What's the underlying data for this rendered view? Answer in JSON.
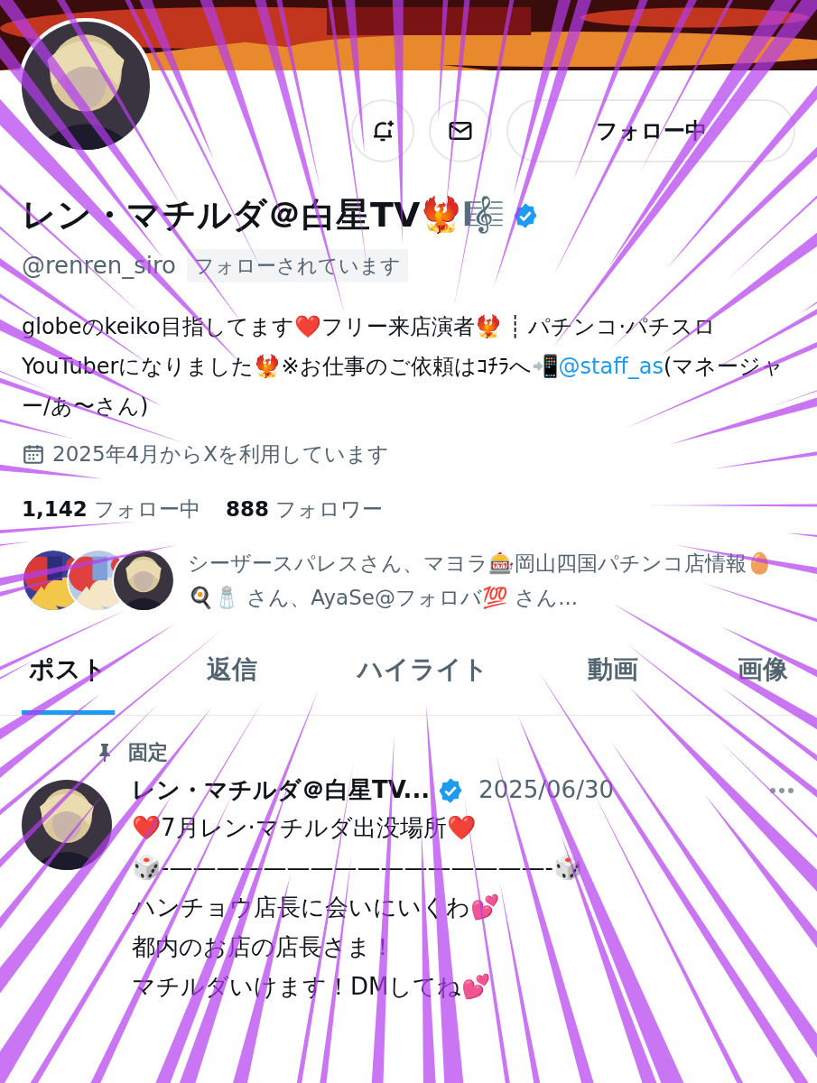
{
  "profile": {
    "name": "レン・マチルダ＠白星TV🐦‍🔥🎼",
    "verified": true,
    "handle": "@renren_siro",
    "follows_you": "フォローされています",
    "follow_button": "フォロー中",
    "bio": {
      "before": "globeのkeiko目指してます❤️フリー来店演者🐦‍🔥 ┊ パチンコ·パチスロYouTuberになりました🐦‍🔥※お仕事のご依頼はｺﾁﾗへ📲",
      "link": "@staff_as",
      "after": "(マネージャー/あ〜さん)"
    },
    "joined": "2025年4月からXを利用しています",
    "following_count": "1,142",
    "following_label": "フォロー中",
    "followers_count": "888",
    "followers_label": "フォロワー",
    "followed_by": "シーザースパレスさん、マヨラ🎰岡山四国パチンコ店情報🥚 🍳🧂 さん、AyaSe@フォロバ💯 さん..."
  },
  "tabs": [
    {
      "label": "ポスト",
      "selected": true
    },
    {
      "label": "返信",
      "selected": false
    },
    {
      "label": "ハイライト",
      "selected": false
    },
    {
      "label": "動画",
      "selected": false
    },
    {
      "label": "画像",
      "selected": false
    }
  ],
  "pinned_post": {
    "pinned_label": "固定",
    "author": "レン・マチルダ＠白星TV...",
    "verified": true,
    "date": "2025/06/30",
    "lines": [
      "❤️7月レン·マチルダ出没場所❤️",
      "🎲-————————————————-🎲",
      "ハンチョウ店長に会いにいくわ💕",
      "都内のお店の店長さま！",
      "マチルダいけます！DMしてね💕"
    ]
  }
}
